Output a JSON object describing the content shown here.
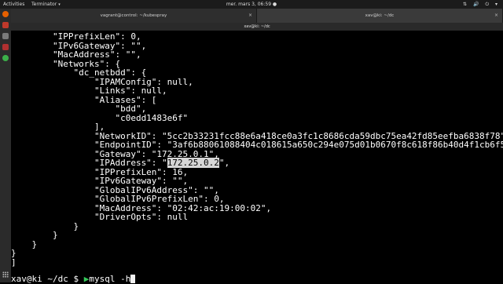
{
  "topbar": {
    "activities": "Activities",
    "app_name": "Terminator",
    "clock": "mer. mars  3, 06:59 ●",
    "sys_icons": "⇅ 🔊 ⏻ ▾"
  },
  "tabs": [
    {
      "title": "vagrant@control: ~/kubespray",
      "close": "×"
    },
    {
      "title": "xav@ki: ~/dc",
      "close": "×"
    }
  ],
  "window_title": "xav@ki: ~/dc",
  "terminal_lines": [
    {
      "text": "        \"IPPrefixLen\": 0,"
    },
    {
      "text": "        \"IPv6Gateway\": \"\","
    },
    {
      "text": "        \"MacAddress\": \"\","
    },
    {
      "text": "        \"Networks\": {"
    },
    {
      "text": "            \"dc_netbdd\": {"
    },
    {
      "text": "                \"IPAMConfig\": null,"
    },
    {
      "text": "                \"Links\": null,"
    },
    {
      "text": "                \"Aliases\": ["
    },
    {
      "text": "                    \"bdd\","
    },
    {
      "text": "                    \"c0edd1483e6f\""
    },
    {
      "text": "                ],"
    },
    {
      "text": "                \"NetworkID\": \"5cc2b33231fcc88e6a418ce0a3fc1c8686cda59dbc75ea42fd85eefba6838f78\","
    },
    {
      "text": "                \"EndpointID\": \"3af6b88061088404c018615a650c294e075d01b0670f8c618f86b40d4f1cb6f5\","
    },
    {
      "text": "                \"Gateway\": \"172.25.0.1\","
    },
    {
      "pre": "                \"IPAddress\": \"",
      "hl": "172.25.0.2",
      "post": "\","
    },
    {
      "text": "                \"IPPrefixLen\": 16,"
    },
    {
      "text": "                \"IPv6Gateway\": \"\","
    },
    {
      "text": "                \"GlobalIPv6Address\": \"\","
    },
    {
      "text": "                \"GlobalIPv6PrefixLen\": 0,"
    },
    {
      "text": "                \"MacAddress\": \"02:42:ac:19:00:02\","
    },
    {
      "text": "                \"DriverOpts\": null"
    },
    {
      "text": "            }"
    },
    {
      "text": "        }"
    },
    {
      "text": "    }"
    },
    {
      "text": "}"
    },
    {
      "text": "]"
    }
  ],
  "prompt": {
    "user_host": "xav@ki",
    "dir": " ~/dc $ ",
    "arrow": "▶",
    "command": "mysql -h"
  }
}
